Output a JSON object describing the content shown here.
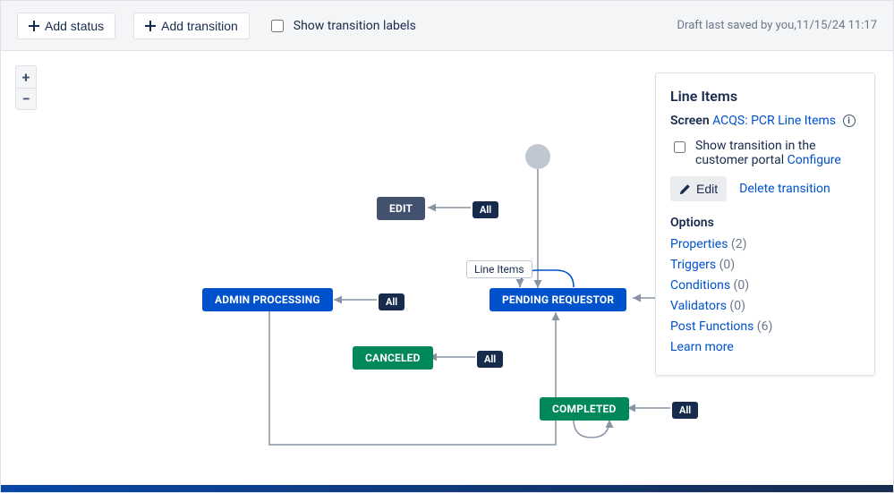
{
  "toolbar": {
    "add_status": "Add status",
    "add_transition": "Add transition",
    "show_labels": "Show transition labels",
    "saved_text": "Draft last saved by you,11/15/24 11:17"
  },
  "zoom": {
    "plus": "+",
    "minus": "−"
  },
  "nodes": {
    "edit": "EDIT",
    "admin_processing": "ADMIN PROCESSING",
    "pending_requestor": "PENDING REQUESTOR",
    "canceled": "CANCELED",
    "completed": "COMPLETED"
  },
  "badges": {
    "all": "All"
  },
  "transition_label": "Line Items",
  "panel": {
    "title": "Line Items",
    "screen_label": "Screen",
    "screen_link": "ACQS: PCR Line Items",
    "show_portal": "Show transition in the customer portal",
    "configure": "Configure",
    "edit": "Edit",
    "delete": "Delete transition",
    "options_heading": "Options",
    "options": [
      {
        "label": "Properties",
        "count": "(2)"
      },
      {
        "label": "Triggers",
        "count": "(0)"
      },
      {
        "label": "Conditions",
        "count": "(0)"
      },
      {
        "label": "Validators",
        "count": "(0)"
      },
      {
        "label": "Post Functions",
        "count": "(6)"
      }
    ],
    "learn_more": "Learn more"
  }
}
